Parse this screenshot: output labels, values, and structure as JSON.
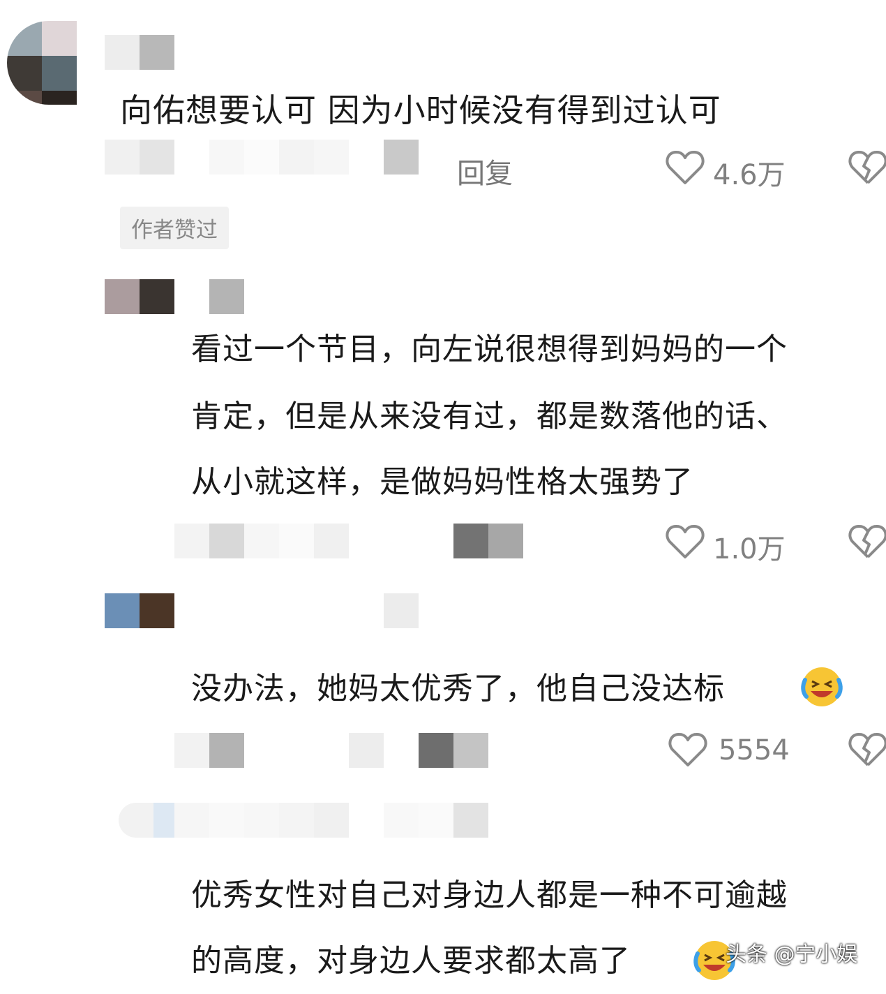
{
  "comments": [
    {
      "text": "向佑想要认可 因为小时候没有得到过认可",
      "reply_label": "回复",
      "like_count": "4.6万",
      "author_liked_tag": "作者赞过"
    },
    {
      "lines": [
        "看过一个节目，向左说很想得到妈妈的一个",
        "肯定，但是从来没有过，都是数落他的话、",
        "从小就这样，是做妈妈性格太强势了"
      ],
      "like_count": "1.0万"
    },
    {
      "text": "没办法，她妈太优秀了，他自己没达标",
      "emoji": "laughing-crying-emoji",
      "like_count": "5554"
    },
    {
      "lines": [
        "优秀女性对自己对身边人都是一种不可逾越",
        "的高度，对身边人要求都太高了"
      ],
      "emoji": "laughing-crying-emoji"
    }
  ],
  "watermark": "头条 @宁小娱",
  "colors": {
    "like_icon": "#8a8a8a",
    "tag_bg": "#f1f1f1",
    "mosaic_gray": "#b0b0b0"
  }
}
